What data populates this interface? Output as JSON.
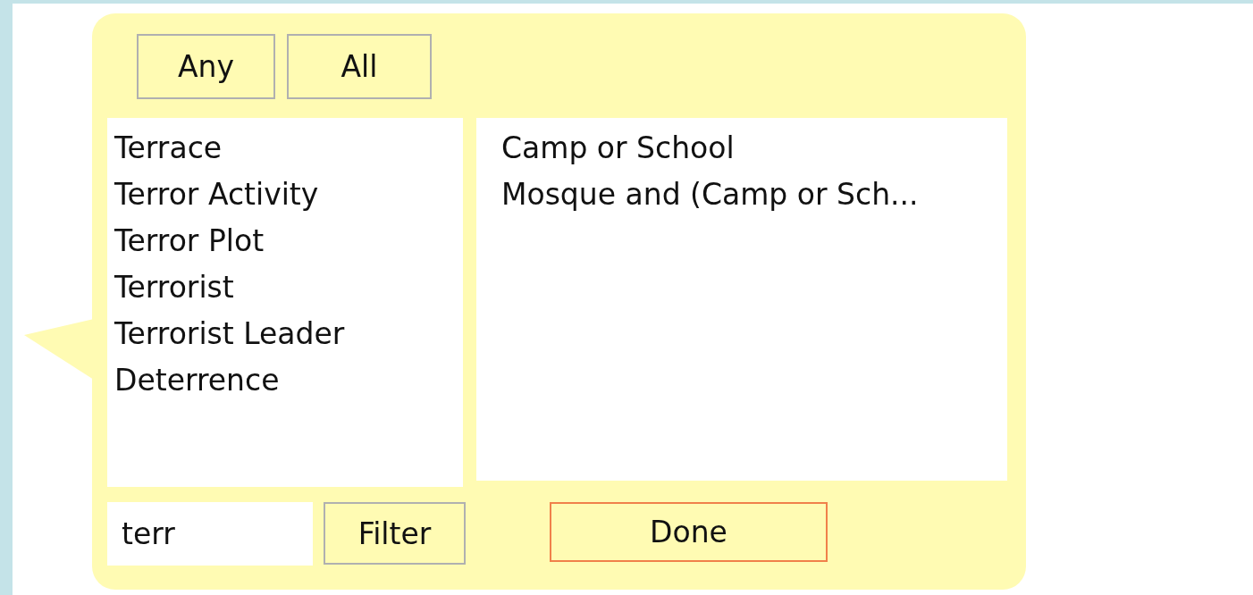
{
  "match_buttons": [
    {
      "label": "Any"
    },
    {
      "label": "All"
    }
  ],
  "terms": [
    {
      "label": "Terrace"
    },
    {
      "label": "Terror Activity"
    },
    {
      "label": "Terror Plot"
    },
    {
      "label": "Terrorist"
    },
    {
      "label": "Terrorist Leader"
    },
    {
      "label": "Deterrence"
    }
  ],
  "queries": [
    {
      "label": "Camp or School"
    },
    {
      "label": "Mosque and (Camp or Sch..."
    }
  ],
  "filter": {
    "value": "terr",
    "button": "Filter"
  },
  "done_button": "Done"
}
